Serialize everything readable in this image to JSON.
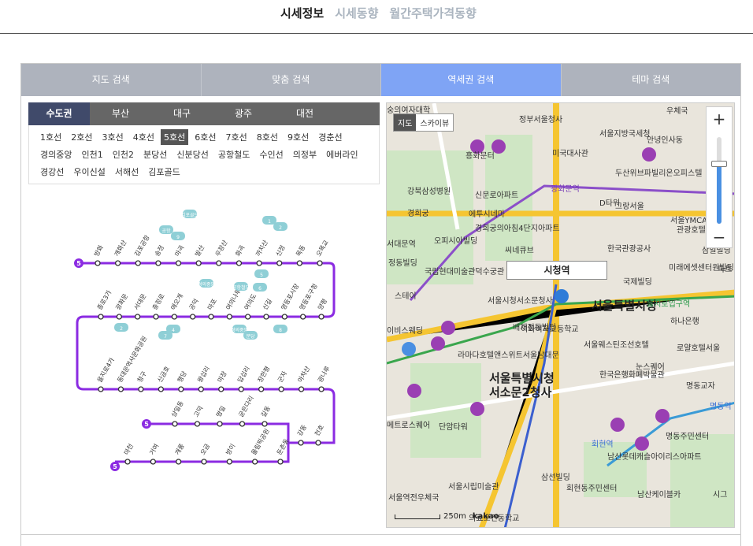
{
  "topnav": {
    "links": [
      {
        "label": "시세정보",
        "active": true
      },
      {
        "label": "시세동향",
        "active": false
      },
      {
        "label": "월간주택가격동향",
        "active": false
      }
    ]
  },
  "search_tabs": [
    {
      "label": "지도 검색",
      "active": false
    },
    {
      "label": "맞춤 검색",
      "active": false
    },
    {
      "label": "역세권 검색",
      "active": true
    },
    {
      "label": "테마 검색",
      "active": false
    }
  ],
  "regions": [
    {
      "label": "수도권",
      "active": true
    },
    {
      "label": "부산",
      "active": false
    },
    {
      "label": "대구",
      "active": false
    },
    {
      "label": "광주",
      "active": false
    },
    {
      "label": "대전",
      "active": false
    }
  ],
  "lines": [
    [
      "1호선",
      "2호선",
      "3호선",
      "4호선",
      "5호선",
      "6호선",
      "7호선",
      "8호선",
      "9호선",
      "경춘선"
    ],
    [
      "경의중앙",
      "인천1",
      "인천2",
      "분당선",
      "신분당선",
      "공항철도",
      "수인선",
      "의정부",
      "에버라인"
    ],
    [
      "경강선",
      "우이신설",
      "서해선",
      "김포골드"
    ]
  ],
  "active_line": "5호선",
  "diagram": {
    "line_badge": "5",
    "line_color": "#8b2be2",
    "row1": [
      "방화",
      "개화산",
      "김포공항",
      "송정",
      "마곡",
      "발산",
      "우장산",
      "화곡",
      "까치산",
      "신정",
      "목동",
      "오목교"
    ],
    "row2": [
      "양평",
      "영등포구청",
      "영등포시장",
      "신길",
      "여의도",
      "여의나루",
      "마포",
      "공덕",
      "애오개",
      "충정로",
      "서대문",
      "광화문",
      "종로3가"
    ],
    "row3": [
      "을지로4가",
      "동대문역사문화공원",
      "청구",
      "신금호",
      "행당",
      "왕십리",
      "마장",
      "답십리",
      "장한평",
      "군자",
      "아차산",
      "광나루"
    ],
    "row4": [
      "상일동",
      "고덕",
      "명일",
      "굳은다리",
      "길동"
    ],
    "row4b": [
      "강동",
      "천호"
    ],
    "row5": [
      "마천",
      "거여",
      "개롱",
      "오금",
      "방이",
      "올림픽공원",
      "둔촌동"
    ],
    "transfer_labels": [
      "김포골드",
      "공항",
      "9",
      "5",
      "6",
      "공항철도",
      "경의중앙",
      "1",
      "2",
      "4",
      "2",
      "경의중앙",
      "분당",
      "7",
      "8"
    ]
  },
  "map": {
    "view_toggle": [
      "지도",
      "스카이뷰"
    ],
    "callout": "시청역",
    "labels": [
      {
        "text": "서울특별시청",
        "cls": "big"
      },
      {
        "text": "서울특별시청",
        "cls": "big"
      },
      {
        "text": "서소문2청사",
        "cls": "big"
      },
      {
        "text": "정부서울청사",
        "cls": ""
      },
      {
        "text": "서울지방국세청",
        "cls": ""
      },
      {
        "text": "우체국",
        "cls": ""
      },
      {
        "text": "광화문역",
        "cls": "purple"
      },
      {
        "text": "을지로입구역",
        "cls": "green"
      },
      {
        "text": "명동역",
        "cls": "blue"
      },
      {
        "text": "회현역",
        "cls": "blue"
      },
      {
        "text": "미국대사관",
        "cls": ""
      },
      {
        "text": "D타워",
        "cls": ""
      },
      {
        "text": "그랑서울",
        "cls": ""
      },
      {
        "text": "안녕인사동",
        "cls": ""
      },
      {
        "text": "두산위브파빌리온오피스텔",
        "cls": ""
      },
      {
        "text": "서울YMCA",
        "cls": ""
      },
      {
        "text": "관광호텔",
        "cls": ""
      },
      {
        "text": "삼일빌딩",
        "cls": ""
      },
      {
        "text": "한국관광공사",
        "cls": ""
      },
      {
        "text": "미래에셋센터원빌딩",
        "cls": ""
      },
      {
        "text": "국제빌딩",
        "cls": ""
      },
      {
        "text": "하나은행",
        "cls": ""
      },
      {
        "text": "로얄호텔서울",
        "cls": ""
      },
      {
        "text": "서울웨스틴조선호텔",
        "cls": ""
      },
      {
        "text": "눈스퀘어",
        "cls": ""
      },
      {
        "text": "한국은행화폐박물관",
        "cls": ""
      },
      {
        "text": "명동교자",
        "cls": ""
      },
      {
        "text": "명동주민센터",
        "cls": ""
      },
      {
        "text": "남산롯데캐슬아이리스아파트",
        "cls": ""
      },
      {
        "text": "남산케이블카",
        "cls": ""
      },
      {
        "text": "회현동주민센터",
        "cls": ""
      },
      {
        "text": "삼선빌딩",
        "cls": ""
      },
      {
        "text": "단암타워",
        "cls": ""
      },
      {
        "text": "라마다호텔앤스위트서울남대문",
        "cls": ""
      },
      {
        "text": "배재정동빌딩",
        "cls": ""
      },
      {
        "text": "이화여자고등학교",
        "cls": ""
      },
      {
        "text": "서울시청서소문청사",
        "cls": ""
      },
      {
        "text": "국립현대미술관덕수궁관",
        "cls": ""
      },
      {
        "text": "정동빌딩",
        "cls": ""
      },
      {
        "text": "강북삼성병원",
        "cls": ""
      },
      {
        "text": "경희궁",
        "cls": ""
      },
      {
        "text": "에투시네마",
        "cls": ""
      },
      {
        "text": "흥화문터",
        "cls": ""
      },
      {
        "text": "신문로아파트",
        "cls": ""
      },
      {
        "text": "경희궁의아침4단지아파트",
        "cls": ""
      },
      {
        "text": "오피시아빌딩",
        "cls": ""
      },
      {
        "text": "씨네큐브",
        "cls": ""
      },
      {
        "text": "서울시립미술관",
        "cls": ""
      },
      {
        "text": "서울역전우체국",
        "cls": ""
      },
      {
        "text": "의료보건동학교",
        "cls": ""
      },
      {
        "text": "메트로스퀘어",
        "cls": ""
      },
      {
        "text": "이비스웨딩",
        "cls": ""
      },
      {
        "text": "스테이",
        "cls": ""
      },
      {
        "text": "서대문역",
        "cls": ""
      },
      {
        "text": "파트",
        "cls": ""
      },
      {
        "text": "시그",
        "cls": ""
      },
      {
        "text": "숭의여자대학",
        "cls": ""
      }
    ],
    "scale_label": "250m",
    "brand": "kakao"
  }
}
